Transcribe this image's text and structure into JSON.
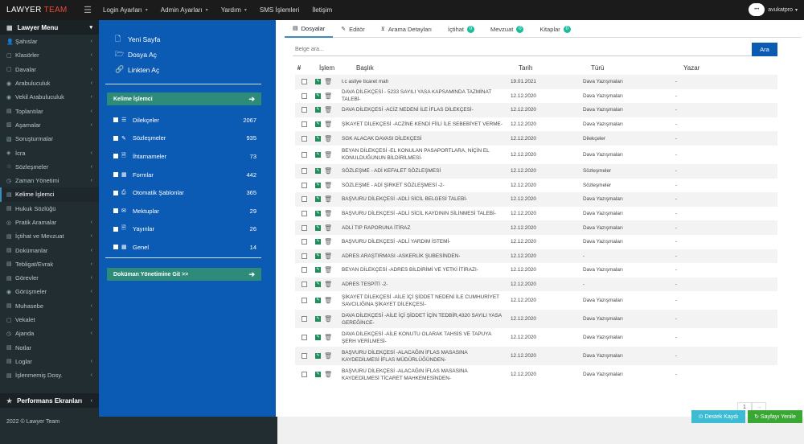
{
  "brand": {
    "prefix": "LAWYER",
    "suffix": " TEAM"
  },
  "topnav": [
    {
      "label": "Login Ayarları",
      "caret": true
    },
    {
      "label": "Admin Ayarları",
      "caret": true
    },
    {
      "label": "Yardım",
      "caret": true
    },
    {
      "label": "SMS İşlemleri",
      "caret": false
    },
    {
      "label": "İletişim",
      "caret": false
    }
  ],
  "user": {
    "name": "avukatpro",
    "avatar_text": "•••"
  },
  "sidebar": {
    "head": "Lawyer Menu",
    "items": [
      {
        "label": "Şahıslar",
        "arrow": true,
        "active": false
      },
      {
        "label": "Klasörler",
        "arrow": true,
        "active": false
      },
      {
        "label": "Davalar",
        "arrow": true,
        "active": false
      },
      {
        "label": "Arabuluculuk",
        "arrow": true,
        "active": false
      },
      {
        "label": "Vekil Arabuluculuk",
        "arrow": true,
        "active": false
      },
      {
        "label": "Toplantılar",
        "arrow": true,
        "active": false
      },
      {
        "label": "Aşamalar",
        "arrow": true,
        "active": false
      },
      {
        "label": "Soruşturmalar",
        "arrow": false,
        "active": false
      },
      {
        "label": "İcra",
        "arrow": true,
        "active": false
      },
      {
        "label": "Sözleşmeler",
        "arrow": true,
        "active": false
      },
      {
        "label": "Zaman Yönetimi",
        "arrow": true,
        "active": false
      },
      {
        "label": "Kelime İşlemci",
        "arrow": false,
        "active": true
      },
      {
        "label": "Hukuk Sözlüğü",
        "arrow": false,
        "active": false
      },
      {
        "label": "Pratik Aramalar",
        "arrow": true,
        "active": false
      },
      {
        "label": "İçtihat ve Mevzuat",
        "arrow": true,
        "active": false
      },
      {
        "label": "Dokümanlar",
        "arrow": true,
        "active": false
      },
      {
        "label": "Tebligat/Evrak",
        "arrow": true,
        "active": false
      },
      {
        "label": "Görevler",
        "arrow": true,
        "active": false
      },
      {
        "label": "Görüşmeler",
        "arrow": true,
        "active": false
      },
      {
        "label": "Muhasebe",
        "arrow": true,
        "active": false
      },
      {
        "label": "Vekalet",
        "arrow": true,
        "active": false
      },
      {
        "label": "Ajanda",
        "arrow": true,
        "active": false
      },
      {
        "label": "Notlar",
        "arrow": false,
        "active": false
      },
      {
        "label": "Loglar",
        "arrow": true,
        "active": false
      },
      {
        "label": "İşlenmemiş Dosy.",
        "arrow": true,
        "active": false
      }
    ],
    "perf_head": "Performans Ekranları",
    "copyright": "2022 © Lawyer Team"
  },
  "bluepanel": {
    "actions": [
      {
        "label": "Yeni Sayfa",
        "icon": "new-page-icon"
      },
      {
        "label": "Dosya Aç",
        "icon": "folder-open-icon"
      },
      {
        "label": "Linkten Aç",
        "icon": "link-icon"
      }
    ],
    "green1": "Kelime İşlemci",
    "green2": "Doküman Yönetimine Git >>",
    "categories": [
      {
        "label": "Dilekçeler",
        "count": "2067",
        "icon": "list-icon"
      },
      {
        "label": "Sözleşmeler",
        "count": "935",
        "icon": "edit-icon"
      },
      {
        "label": "İhtarnameler",
        "count": "73",
        "icon": "document-icon"
      },
      {
        "label": "Formlar",
        "count": "442",
        "icon": "table-icon"
      },
      {
        "label": "Otomatik Şablonlar",
        "count": "365",
        "icon": "print-icon"
      },
      {
        "label": "Mektuplar",
        "count": "29",
        "icon": "envelope-icon"
      },
      {
        "label": "Yayınlar",
        "count": "26",
        "icon": "document-icon"
      },
      {
        "label": "Genel",
        "count": "14",
        "icon": "grid-icon"
      }
    ]
  },
  "tabs": [
    {
      "label": "Dosyalar",
      "badge": null,
      "active": true
    },
    {
      "label": "Editör",
      "badge": null,
      "active": false
    },
    {
      "label": "Arama Detayları",
      "badge": null,
      "active": false
    },
    {
      "label": "İçtihat",
      "badge": "0",
      "active": false
    },
    {
      "label": "Mevzuat",
      "badge": "0",
      "active": false
    },
    {
      "label": "Kitaplar",
      "badge": "0",
      "active": false
    }
  ],
  "search": {
    "placeholder": "Belge ara...",
    "button": "Ara"
  },
  "table": {
    "headers": [
      "#",
      "İşlem",
      "Başlık",
      "Tarih",
      "Türü",
      "Yazar"
    ],
    "rows": [
      {
        "title": "t.c asliye ticaret mah",
        "date": "19.01.2021",
        "type": "Dava Yazışmaları",
        "writer": "-",
        "lines": 1
      },
      {
        "title": "DAVA DİLEKÇESİ - 5233 SAYILI YASA KAPSAMINDA TAZMİNAT TALEBİ-",
        "date": "12.12.2020",
        "type": "Dava Yazışmaları",
        "writer": "-",
        "lines": 1
      },
      {
        "title": "DAVA DİLEKÇESİ -ACİZ NEDENİ İLE İFLAS DİLEKÇESİ-",
        "date": "12.12.2020",
        "type": "Dava Yazışmaları",
        "writer": "-",
        "lines": 1
      },
      {
        "title": "ŞİKAYET DİLEKÇESİ -ACZİNE KENDİ FİİLİ İLE SEBEBİYET VERME-",
        "date": "12.12.2020",
        "type": "Dava Yazışmaları",
        "writer": "-",
        "lines": 1
      },
      {
        "title": "SGK ALACAK DAVASI DİLEKÇESİ",
        "date": "12.12.2020",
        "type": "Dilekçeler",
        "writer": "-",
        "lines": 1
      },
      {
        "title": "BEYAN DİLEKÇESİ -EL KONULAN PASAPORTLARA, NİÇİN EL KONULDUĞUNUN BİLDİRİLMESİ-",
        "date": "12.12.2020",
        "type": "Dava Yazışmaları",
        "writer": "-",
        "lines": 2
      },
      {
        "title": "SÖZLEŞME - ADİ KEFALET SÖZLEŞMESİ",
        "date": "12.12.2020",
        "type": "Sözleşmeler",
        "writer": "-",
        "lines": 1
      },
      {
        "title": "SÖZLEŞME - ADİ ŞİRKET SÖZLEŞMESİ -2-",
        "date": "12.12.2020",
        "type": "Sözleşmeler",
        "writer": "-",
        "lines": 1
      },
      {
        "title": "BAŞVURU DİLEKÇESİ -ADLİ SİCİL BELGESİ TALEBİ-",
        "date": "12.12.2020",
        "type": "Dava Yazışmaları",
        "writer": "-",
        "lines": 1
      },
      {
        "title": "BAŞVURU DİLEKÇESİ -ADLİ SİCİL KAYDININ SİLİNMESİ TALEBİ-",
        "date": "12.12.2020",
        "type": "Dava Yazışmaları",
        "writer": "-",
        "lines": 1
      },
      {
        "title": "ADLİ TIP RAPORUNA İTİRAZ",
        "date": "12.12.2020",
        "type": "Dava Yazışmaları",
        "writer": "-",
        "lines": 1
      },
      {
        "title": "BAŞVURU DİLEKÇESİ -ADLİ YARDIM İSTEMİ-",
        "date": "12.12.2020",
        "type": "Dava Yazışmaları",
        "writer": "-",
        "lines": 1
      },
      {
        "title": "ADRES ARAŞTIRMASI -ASKERLİK ŞUBESİNDEN-",
        "date": "12.12.2020",
        "type": "-",
        "writer": "-",
        "lines": 1
      },
      {
        "title": "BEYAN DİLEKÇESİ -ADRES BİLDİRİMİ VE YETKİ İTİRAZI-",
        "date": "12.12.2020",
        "type": "Dava Yazışmaları",
        "writer": "-",
        "lines": 1
      },
      {
        "title": "ADRES TESPİTİ -2-",
        "date": "12.12.2020",
        "type": "-",
        "writer": "-",
        "lines": 1
      },
      {
        "title": "ŞİKAYET DİLEKÇESİ -AİLE İÇİ ŞİDDET NEDENİ İLE CUMHURİYET SAVCILIĞINA ŞİKAYET DİLEKÇESİ-",
        "date": "12.12.2020",
        "type": "Dava Yazışmaları",
        "writer": "-",
        "lines": 2
      },
      {
        "title": "DAVA DİLEKÇESİ -AİLE İÇİ ŞİDDET İÇİN TEDBİR,4320 SAYILI YASA GEREĞİNCE-",
        "date": "12.12.2020",
        "type": "Dava Yazışmaları",
        "writer": "-",
        "lines": 2
      },
      {
        "title": "DAVA DİLEKÇESİ -AİLE KONUTU OLARAK TAHSİS VE TAPUYA ŞERH VERİLMESİ-",
        "date": "12.12.2020",
        "type": "Dava Yazışmaları",
        "writer": "-",
        "lines": 2
      },
      {
        "title": "BAŞVURU DİLEKÇESİ -ALACAĞIN İFLAS MASASINA KAYDEDİLMESİ İFLAS MÜDÜRLÜĞÜNDEN-",
        "date": "12.12.2020",
        "type": "Dava Yazışmaları",
        "writer": "-",
        "lines": 2
      },
      {
        "title": "BAŞVURU DİLEKÇESİ -ALACAĞIN İFLAS MASASINA KAYDEDİLMESİ TİCARET MAHKEMESİNDEN-",
        "date": "12.12.2020",
        "type": "Dava Yazışmaları",
        "writer": "-",
        "lines": 2
      }
    ]
  },
  "pager": {
    "current": "1",
    "next": "→"
  },
  "buttons": {
    "destek": "Destek Kaydı",
    "yenile": "Sayfayı Yenile"
  },
  "colors": {
    "blue_panel": "#0b5bb5",
    "green_bar": "#2e8b7a",
    "badge": "#1abc9c",
    "destek": "#3bbcd3",
    "yenile": "#3aa735"
  }
}
